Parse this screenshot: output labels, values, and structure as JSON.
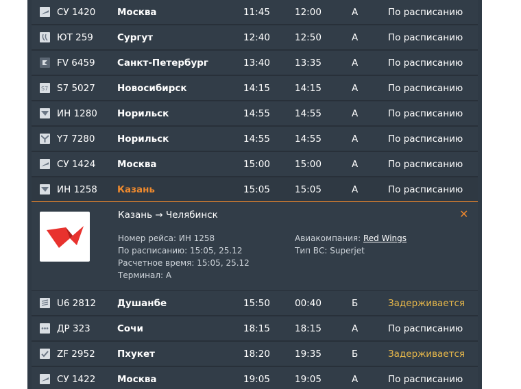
{
  "flights_top": [
    {
      "flight": "СУ 1420",
      "city": "Москва",
      "scheduled": "11:45",
      "estimated": "12:00",
      "terminal": "A",
      "status": "По расписанию",
      "logo": "aeroflot-icon"
    },
    {
      "flight": "ЮТ 259",
      "city": "Сургут",
      "scheduled": "12:40",
      "estimated": "12:50",
      "terminal": "A",
      "status": "По расписанию",
      "logo": "utair-icon"
    },
    {
      "flight": "FV 6459",
      "city": "Санкт-Петербург",
      "scheduled": "13:40",
      "estimated": "13:35",
      "terminal": "A",
      "status": "По расписанию",
      "logo": "rossiya-icon"
    },
    {
      "flight": "S7 5027",
      "city": "Новосибирск",
      "scheduled": "14:15",
      "estimated": "14:15",
      "terminal": "A",
      "status": "По расписанию",
      "logo": "s7-icon"
    },
    {
      "flight": "ИН 1280",
      "city": "Норильск",
      "scheduled": "14:55",
      "estimated": "14:55",
      "terminal": "A",
      "status": "По расписанию",
      "logo": "nordwind-icon"
    },
    {
      "flight": "Y7 7280",
      "city": "Норильск",
      "scheduled": "14:55",
      "estimated": "14:55",
      "terminal": "A",
      "status": "По расписанию",
      "logo": "nordstar-icon"
    },
    {
      "flight": "СУ 1424",
      "city": "Москва",
      "scheduled": "15:00",
      "estimated": "15:00",
      "terminal": "A",
      "status": "По расписанию",
      "logo": "aeroflot-icon"
    },
    {
      "flight": "ИН 1258",
      "city": "Казань",
      "scheduled": "15:05",
      "estimated": "15:05",
      "terminal": "A",
      "status": "По расписанию",
      "logo": "redwings-icon"
    }
  ],
  "detail": {
    "route": "Казань → Челябинск",
    "close_glyph": "✕",
    "flight_number": "Номер рейса: ИН 1258",
    "scheduled": "По расписанию: 15:05, 25.12",
    "estimated": "Расчетное время: 15:05, 25.12",
    "terminal": "Терминал: A",
    "airline_label": "Авиакомпания: ",
    "airline_name": "Red Wings",
    "aircraft": "Тип ВС: Superjet",
    "logo_color": "#e8322e"
  },
  "flights_bottom": [
    {
      "flight": "U6 2812",
      "city": "Душанбе",
      "scheduled": "15:50",
      "estimated": "00:40",
      "terminal": "Б",
      "status": "Задерживается",
      "logo": "uralairlines-icon"
    },
    {
      "flight": "ДР 323",
      "city": "Сочи",
      "scheduled": "18:15",
      "estimated": "18:15",
      "terminal": "A",
      "status": "По расписанию",
      "logo": "pobeda-icon"
    },
    {
      "flight": "ZF 2952",
      "city": "Пхукет",
      "scheduled": "18:20",
      "estimated": "19:35",
      "terminal": "Б",
      "status": "Задерживается",
      "logo": "azurair-icon"
    },
    {
      "flight": "СУ 1422",
      "city": "Москва",
      "scheduled": "19:05",
      "estimated": "19:05",
      "terminal": "A",
      "status": "По расписанию",
      "logo": "aeroflot-icon"
    }
  ],
  "colors": {
    "delay": "#e8b84a",
    "highlight": "#ef8a2e",
    "background": "#2f3a45"
  }
}
